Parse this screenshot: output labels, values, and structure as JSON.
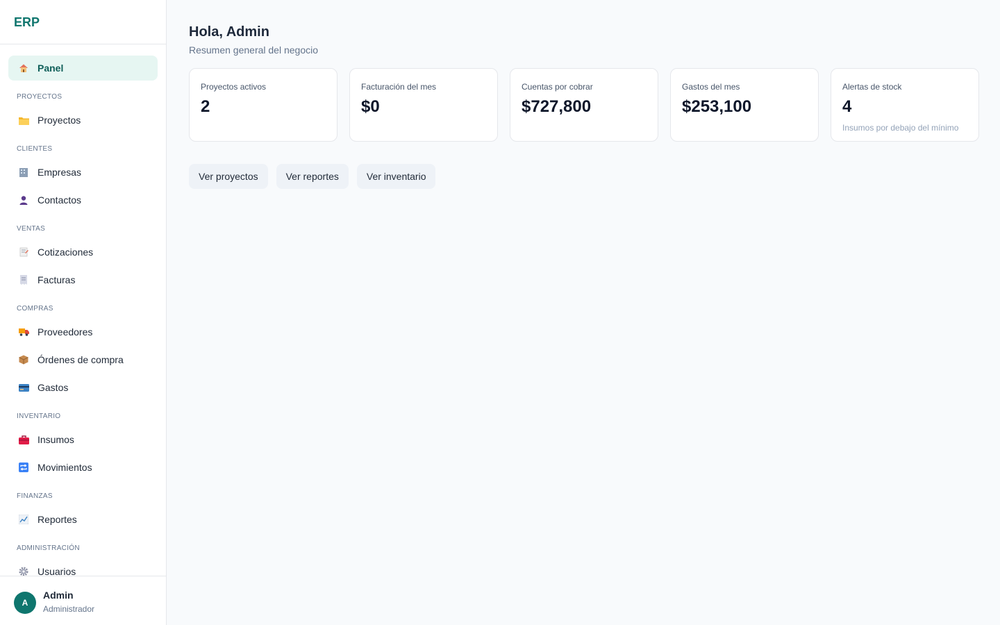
{
  "brand": "ERP",
  "sidebar": {
    "panel": "Panel",
    "sections": {
      "proyectos": "PROYECTOS",
      "clientes": "CLIENTES",
      "ventas": "VENTAS",
      "compras": "COMPRAS",
      "inventario": "INVENTARIO",
      "finanzas": "FINANZAS",
      "administracion": "ADMINISTRACIÓN"
    },
    "items": {
      "proyectos": "Proyectos",
      "empresas": "Empresas",
      "contactos": "Contactos",
      "cotizaciones": "Cotizaciones",
      "facturas": "Facturas",
      "proveedores": "Proveedores",
      "ordenes": "Órdenes de compra",
      "gastos": "Gastos",
      "insumos": "Insumos",
      "movimientos": "Movimientos",
      "reportes": "Reportes",
      "usuarios": "Usuarios"
    },
    "icons": {
      "panel": "house-icon",
      "proyectos": "folder-icon",
      "empresas": "building-icon",
      "contactos": "person-icon",
      "cotizaciones": "memo-icon",
      "facturas": "receipt-icon",
      "proveedores": "truck-icon",
      "ordenes": "package-icon",
      "gastos": "credit-card-icon",
      "insumos": "toolbox-icon",
      "movimientos": "repeat-icon",
      "reportes": "chart-icon",
      "usuarios": "gear-icon"
    }
  },
  "user": {
    "initial": "A",
    "name": "Admin",
    "role": "Administrador"
  },
  "main": {
    "greeting": "Hola, Admin",
    "subtitle": "Resumen general del negocio",
    "cards": [
      {
        "label": "Proyectos activos",
        "value": "2"
      },
      {
        "label": "Facturación del mes",
        "value": "$0"
      },
      {
        "label": "Cuentas por cobrar",
        "value": "$727,800"
      },
      {
        "label": "Gastos del mes",
        "value": "$253,100"
      },
      {
        "label": "Alertas de stock",
        "value": "4",
        "note": "Insumos por debajo del mínimo"
      }
    ],
    "actions": {
      "proyectos": "Ver proyectos",
      "reportes": "Ver reportes",
      "inventario": "Ver inventario"
    }
  },
  "colors": {
    "brand": "#0f766e",
    "active_bg": "#e6f6f2",
    "background": "#f8fafc"
  }
}
